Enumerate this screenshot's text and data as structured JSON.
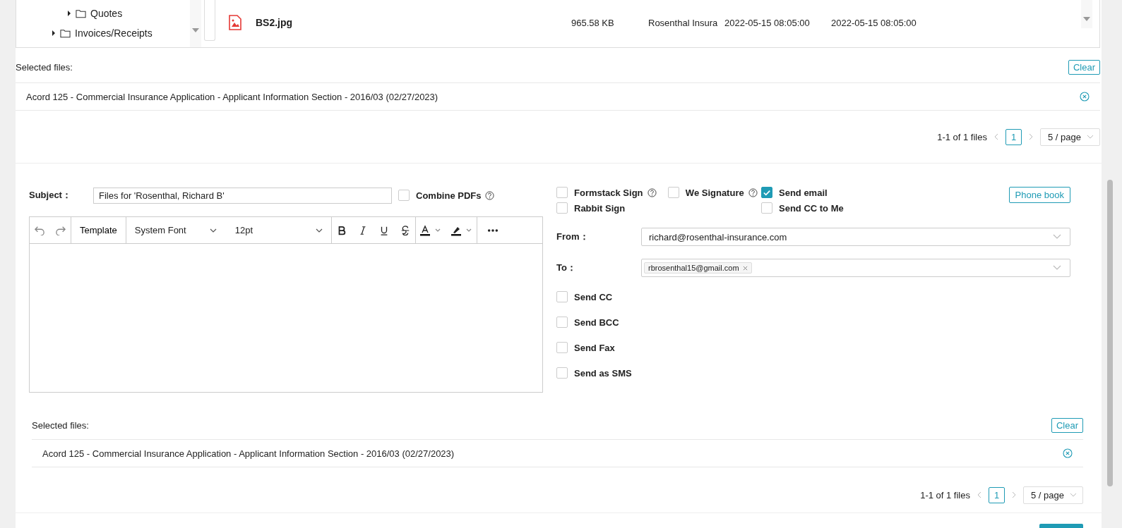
{
  "file_browser": {
    "tree": [
      {
        "children": [
          {
            "label": "Quotes",
            "expanded": false
          }
        ]
      },
      {
        "label": "Invoices/Receipts",
        "expanded": false
      }
    ],
    "files": [
      {
        "name": "BS2.jpg",
        "size": "965.58 KB",
        "owner": "Rosenthal Insura",
        "column_4": "2022-05-15 08:05:00",
        "column_5": "2022-05-15 08:05:00"
      }
    ]
  },
  "selected_top": {
    "label": "Selected files:",
    "clear_button": "Clear",
    "files": [
      "Acord 125 - Commercial Insurance Application - Applicant Information Section - 2016/03 (02/27/2023)"
    ],
    "pagination": {
      "summary": "1-1 of 1 files",
      "pages": [
        {
          "label": "1",
          "selected": true
        }
      ],
      "page_size": "5 / page"
    }
  },
  "compose": {
    "subject_label": "Subject：",
    "subject": "Files for 'Rosenthal, Richard B'",
    "combine_pdfs": {
      "label": "Combine PDFs",
      "checked": false
    },
    "toolbar": {
      "template": "Template",
      "font": "System Font",
      "size": "12pt"
    },
    "signature_options": [
      {
        "label": "Formstack Sign",
        "checked": false,
        "help": true
      },
      {
        "label": "We Signature",
        "checked": false,
        "help": true
      },
      {
        "label": "Rabbit Sign",
        "checked": false,
        "help": false
      }
    ],
    "email_options": [
      {
        "label": "Send email",
        "checked": true
      },
      {
        "label": "Send CC to Me",
        "checked": false
      }
    ],
    "phone_book_button": "Phone book",
    "from_label": "From：",
    "from": "richard@rosenthal-insurance.com",
    "to_label": "To：",
    "to": [
      "rbrosenthal15@gmail.com"
    ],
    "extra_options": [
      {
        "label": "Send CC",
        "checked": false
      },
      {
        "label": "Send BCC",
        "checked": false
      },
      {
        "label": "Send Fax",
        "checked": false
      },
      {
        "label": "Send as SMS",
        "checked": false
      }
    ]
  },
  "selected_bottom": {
    "label": "Selected files:",
    "clear_button": "Clear",
    "files": [
      "Acord 125 - Commercial Insurance Application - Applicant Information Section - 2016/03 (02/27/2023)"
    ],
    "pagination": {
      "summary": "1-1 of 1 files",
      "pages": [
        {
          "label": "1",
          "selected": true
        }
      ],
      "page_size": "5 / page"
    }
  }
}
